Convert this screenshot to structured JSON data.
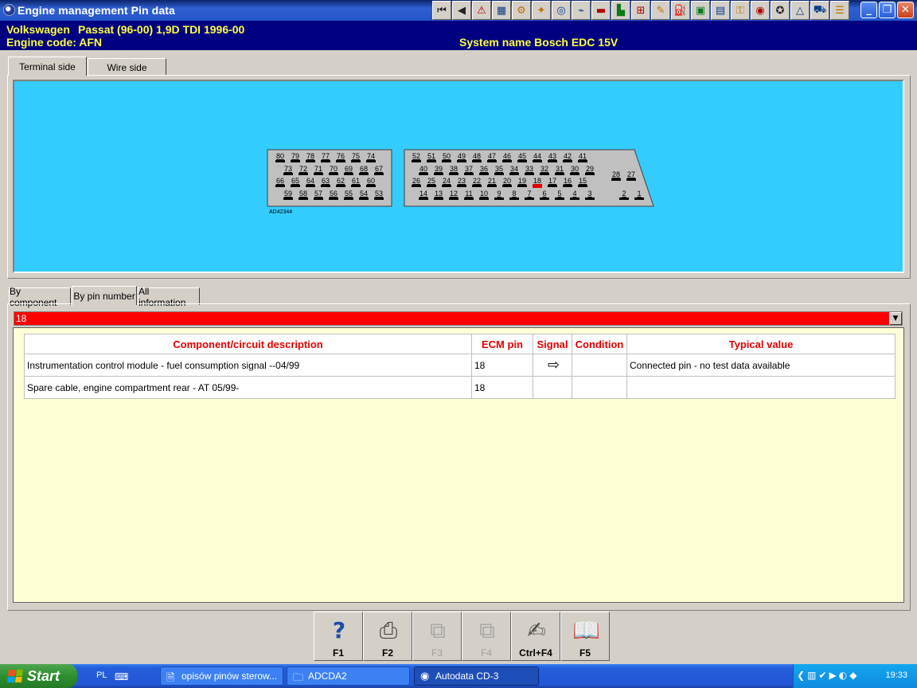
{
  "window": {
    "title": "Engine management Pin data",
    "controls": [
      "minimize",
      "restore",
      "close"
    ]
  },
  "toolbar": {
    "icons": [
      "first-record-icon",
      "previous-icon",
      "warning-icon",
      "map-icon",
      "engine-icon",
      "tools-icon",
      "disc-icon",
      "diagnostics-icon",
      "battery-icon",
      "seat-icon",
      "lift-icon",
      "wrench-icon",
      "fuel-icon",
      "ecu-icon",
      "filter-icon",
      "key-icon",
      "brakes-icon",
      "wheel-icon",
      "triangle-icon",
      "car-icon",
      "note-icon"
    ]
  },
  "vehicle": {
    "make": "Volkswagen",
    "model": "Passat (96-00) 1,9D TDI 1996-00",
    "engine_code": "Engine code: AFN",
    "system_name": "System name Bosch EDC 15V"
  },
  "view_tabs": [
    "Terminal side",
    "Wire side"
  ],
  "connector": {
    "reference": "AD42344",
    "highlighted_pin": "18",
    "left_rows": [
      [
        "80",
        "79",
        "78",
        "77",
        "76",
        "75",
        "74"
      ],
      [
        "73",
        "72",
        "71",
        "70",
        "69",
        "68",
        "67"
      ],
      [
        "66",
        "65",
        "64",
        "63",
        "62",
        "61",
        "60"
      ],
      [
        "59",
        "58",
        "57",
        "56",
        "55",
        "54",
        "53"
      ]
    ],
    "right_rows": [
      [
        "52",
        "51",
        "50",
        "49",
        "48",
        "47",
        "46",
        "45",
        "44",
        "43",
        "42",
        "41"
      ],
      [
        "40",
        "39",
        "38",
        "37",
        "36",
        "35",
        "34",
        "33",
        "32",
        "31",
        "30",
        "29"
      ],
      [
        "26",
        "25",
        "24",
        "23",
        "22",
        "21",
        "20",
        "19",
        "18",
        "17",
        "16",
        "15"
      ],
      [
        "14",
        "13",
        "12",
        "11",
        "10",
        "9",
        "8",
        "7",
        "6",
        "5",
        "4",
        "3"
      ]
    ],
    "side_rows": [
      [
        "28",
        "27"
      ],
      [
        "2",
        "1"
      ]
    ],
    "colors": {
      "background": "#33ccff",
      "block": "#c0c0c0",
      "highlight": "#e00000"
    }
  },
  "data_tabs": [
    "By component",
    "By pin number",
    "All information"
  ],
  "pin_selector": {
    "value": "18"
  },
  "pin_table": {
    "headers": [
      "Component/circuit description",
      "ECM pin",
      "Signal",
      "Condition",
      "Typical value"
    ],
    "rows": [
      {
        "description": "Instrumentation control module - fuel consumption signal --04/99",
        "ecm_pin": "18",
        "signal": "⇨",
        "condition": "",
        "typical": "Connected pin - no test data available"
      },
      {
        "description": "Spare cable, engine compartment rear - AT 05/99-",
        "ecm_pin": "18",
        "signal": "",
        "condition": "",
        "typical": ""
      }
    ]
  },
  "function_keys": [
    {
      "label": "F1",
      "icon": "help-icon",
      "enabled": true
    },
    {
      "label": "F2",
      "icon": "printer-icon",
      "enabled": true
    },
    {
      "label": "F3",
      "icon": "previous-page-icon",
      "enabled": false
    },
    {
      "label": "F4",
      "icon": "next-page-icon",
      "enabled": false
    },
    {
      "label": "Ctrl+F4",
      "icon": "notepad-icon",
      "enabled": true
    },
    {
      "label": "F5",
      "icon": "book-icon",
      "enabled": true
    }
  ],
  "taskbar": {
    "start_label": "Start",
    "language": "PL",
    "tasks": [
      {
        "label": "opisów pinów sterow...",
        "icon": "word-icon"
      },
      {
        "label": "ADCDA2",
        "icon": "folder-icon"
      },
      {
        "label": "Autodata CD-3",
        "icon": "autodata-icon"
      }
    ],
    "clock": "19:33"
  }
}
